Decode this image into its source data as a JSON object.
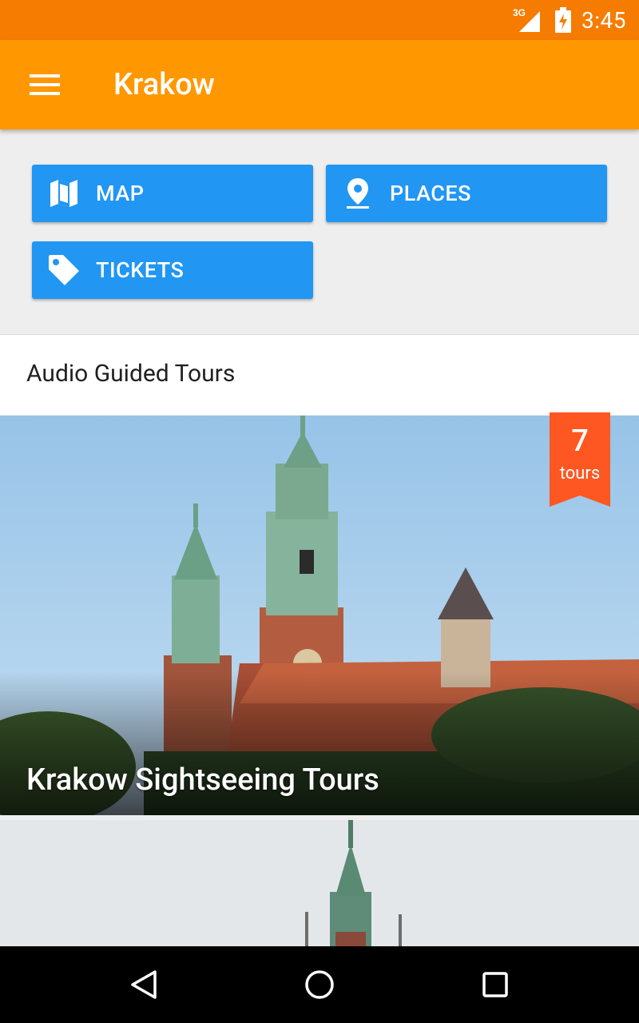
{
  "status_bar": {
    "network": "3G",
    "time": "3:45",
    "icons": [
      "signal-icon",
      "battery-charging-icon"
    ]
  },
  "app_bar": {
    "title": "Krakow",
    "menu_icon": "menu-icon"
  },
  "actions": [
    {
      "label": "MAP",
      "icon": "map-icon"
    },
    {
      "label": "PLACES",
      "icon": "place-icon"
    },
    {
      "label": "TICKETS",
      "icon": "tag-icon"
    }
  ],
  "section": {
    "title": "Audio Guided Tours"
  },
  "tours": [
    {
      "title": "Krakow Sightseeing Tours",
      "badge_count": "7",
      "badge_label": "tours"
    },
    {
      "title": ""
    }
  ],
  "nav": {
    "icons": [
      "back-icon",
      "home-icon",
      "recents-icon"
    ]
  },
  "colors": {
    "status_bar": "#f57c00",
    "app_bar": "#ff9800",
    "button": "#2196f3",
    "badge": "#ff5722"
  }
}
